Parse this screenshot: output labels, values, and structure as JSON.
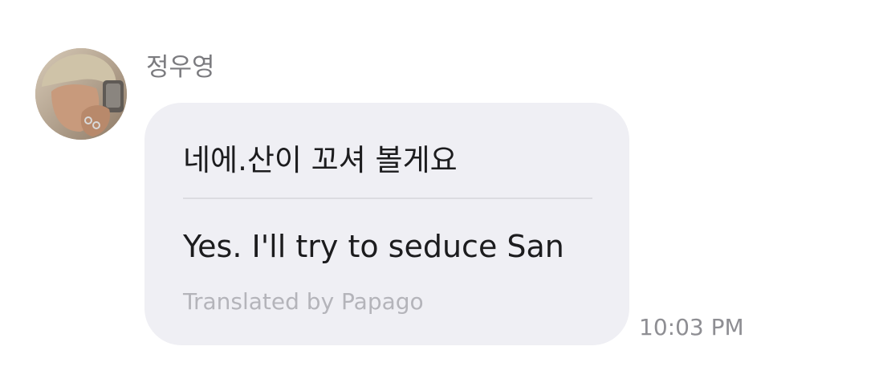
{
  "message": {
    "sender_name": "정우영",
    "avatar": "profile-photo",
    "original_text": "네에.산이 꼬셔 볼게요",
    "translated_text": "Yes. I'll try to seduce San",
    "translation_credit": "Translated by Papago",
    "timestamp": "10:03 PM"
  },
  "colors": {
    "background": "#ffffff",
    "bubble": "#efeff4",
    "text_primary": "#1c1c1e",
    "text_secondary": "#8e8e93",
    "credit": "#b4b4ba"
  }
}
